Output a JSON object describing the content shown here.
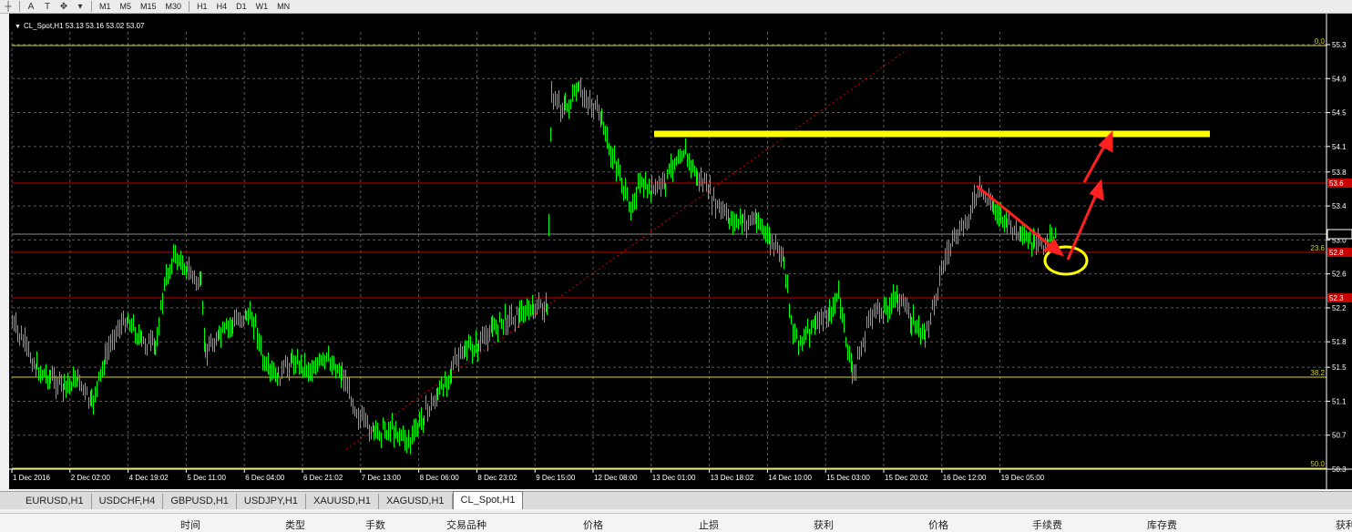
{
  "toolbar": {
    "icons": [
      "crosshair-icon",
      "text-icon",
      "text-label-icon",
      "arrows-icon",
      "dropdown-arrow-icon"
    ],
    "icon_glyphs": [
      "┼",
      "A",
      "T",
      "✥",
      "▾"
    ],
    "timeframes": [
      "M1",
      "M5",
      "M15",
      "M30",
      "H1",
      "H4",
      "D1",
      "W1",
      "MN"
    ]
  },
  "chart": {
    "title": "CL_Spot,H1  53.13 53.16 53.02 53.07",
    "price_labels": [
      "55.3",
      "54.9",
      "54.5",
      "54.1",
      "53.8",
      "53.4",
      "53.0",
      "52.6",
      "52.2",
      "51.8",
      "51.5",
      "51.1",
      "50.7",
      "50.3"
    ],
    "time_labels": [
      "1 Dec 2016",
      "2 Dec 02:00",
      "4 Dec 19:02",
      "5 Dec 11:00",
      "6 Dec 04:00",
      "6 Dec 21:02",
      "7 Dec 13:00",
      "8 Dec 06:00",
      "8 Dec 23:02",
      "9 Dec 15:00",
      "12 Dec 08:00",
      "13 Dec 01:00",
      "13 Dec 18:02",
      "14 Dec 10:00",
      "15 Dec 03:00",
      "15 Dec 20:02",
      "16 Dec 12:00",
      "19 Dec 05:00"
    ],
    "fib_labels": {
      "top": "0.0",
      "mid": "23.6",
      "low": "38.2",
      "bottom": "50.0"
    },
    "red_level_labels": [
      "53.6",
      "52.8",
      "52.3"
    ],
    "colors": {
      "candle": "#00ff00",
      "grid": "#5a5a5a",
      "fib": "#d8d800",
      "redline": "#c80000",
      "annot": "#ffff00",
      "arrow": "#ff2020"
    }
  },
  "tabs": [
    "EURUSD,H1",
    "USDCHF,H4",
    "GBPUSD,H1",
    "USDJPY,H1",
    "XAUUSD,H1",
    "XAGUSD,H1",
    "CL_Spot,H1"
  ],
  "active_tab": "CL_Spot,H1",
  "status_columns": [
    "时间",
    "类型",
    "手数",
    "交易品种",
    "价格",
    "止损",
    "获利",
    "价格",
    "手续费",
    "库存费",
    "获利"
  ]
}
